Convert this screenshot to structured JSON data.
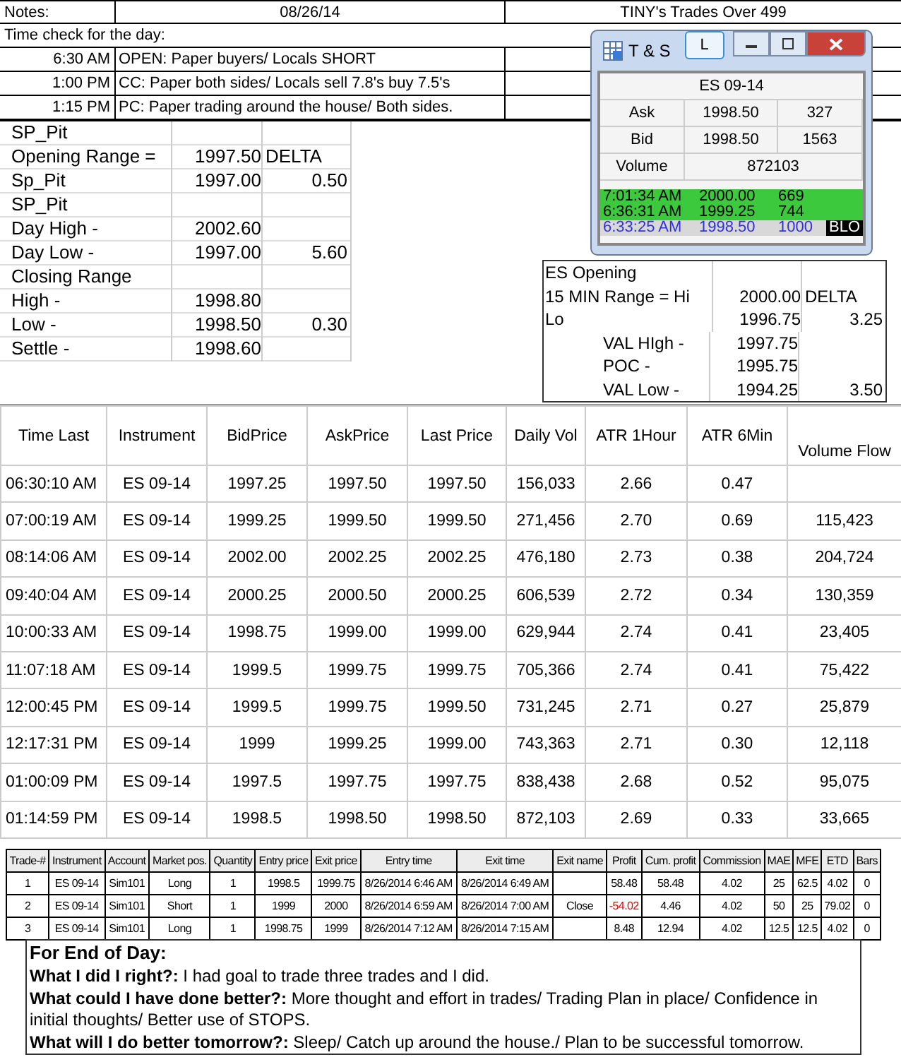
{
  "header": {
    "notes_label": "Notes:",
    "date": "08/26/14",
    "title": "TINY's Trades Over 499"
  },
  "time_check": {
    "title": "Time check for the day:",
    "entries": [
      {
        "time": "6:30 AM",
        "text": "OPEN: Paper buyers/ Locals SHORT"
      },
      {
        "time": "1:00 PM",
        "text": "CC: Paper both sides/ Locals sell 7.8's buy 7.5's"
      },
      {
        "time": "1:15 PM",
        "text": "PC: Paper trading around the house/ Both sides."
      }
    ]
  },
  "sp_pit": [
    {
      "label": "SP_Pit"
    },
    {
      "label": "Opening Range =",
      "value": "1997.50",
      "delta_label": "DELTA"
    },
    {
      "label": "Sp_Pit",
      "value": "1997.00",
      "delta": "0.50"
    },
    {
      "label": "SP_Pit"
    },
    {
      "label": "Day High -",
      "value": "2002.60"
    },
    {
      "label": "Day Low -",
      "value": "1997.00",
      "delta": "5.60"
    },
    {
      "label": "Closing Range"
    },
    {
      "label": "High -",
      "value": "1998.80"
    },
    {
      "label": "Low -",
      "value": "1998.50",
      "delta": "0.30"
    },
    {
      "label": "Settle -",
      "value": "1998.60"
    }
  ],
  "ts_window": {
    "title": "T & S",
    "link_button": "L",
    "symbol": "ES 09-14",
    "quotes": [
      {
        "label": "Ask",
        "price": "1998.50",
        "size": "327"
      },
      {
        "label": "Bid",
        "price": "1998.50",
        "size": "1563"
      }
    ],
    "volume_label": "Volume",
    "volume": "872103",
    "prints": [
      {
        "time": "7:01:34 AM",
        "price": "2000.00",
        "size": "669",
        "color": "#3dc93d"
      },
      {
        "time": "6:36:31 AM",
        "price": "1999.25",
        "size": "744",
        "color": "#3dc93d"
      },
      {
        "time": "6:33:25 AM",
        "price": "1998.50",
        "size": "1000",
        "color": "#d8d8d8",
        "flag": "BLO"
      }
    ]
  },
  "es_opening": [
    {
      "label": "ES Opening",
      "kind": "plain"
    },
    {
      "label": "15 MIN Range = Hi",
      "value": "2000.00",
      "delta_label": "DELTA",
      "kind": "plain"
    },
    {
      "label": "Lo",
      "value": "1996.75",
      "delta": "3.25",
      "kind": "plain"
    },
    {
      "label": "VAL HIgh  -",
      "value": "1997.75",
      "kind": "indented"
    },
    {
      "label": "POC  -",
      "value": "1995.75",
      "kind": "indented"
    },
    {
      "label": "VAL Low  -",
      "value": "1994.25",
      "delta": "3.50",
      "kind": "indented"
    }
  ],
  "market_table": {
    "columns": [
      "Time Last",
      "Instrument",
      "BidPrice",
      "AskPrice",
      "Last Price",
      "Daily Vol",
      "ATR 1Hour",
      "ATR 6Min",
      "Volume Flow"
    ],
    "rows": [
      [
        "06:30:10 AM",
        "ES 09-14",
        "1997.25",
        "1997.50",
        "1997.50",
        "156,033",
        "2.66",
        "0.47"
      ],
      [
        "07:00:19 AM",
        "ES 09-14",
        "1999.25",
        "1999.50",
        "1999.50",
        "271,456",
        "2.70",
        "0.69",
        "115,423"
      ],
      [
        "08:14:06 AM",
        "ES 09-14",
        "2002.00",
        "2002.25",
        "2002.25",
        "476,180",
        "2.73",
        "0.38",
        "204,724"
      ],
      [
        "09:40:04 AM",
        "ES 09-14",
        "2000.25",
        "2000.50",
        "2000.25",
        "606,539",
        "2.72",
        "0.34",
        "130,359"
      ],
      [
        "10:00:33 AM",
        "ES 09-14",
        "1998.75",
        "1999.00",
        "1999.00",
        "629,944",
        "2.74",
        "0.41",
        "23,405"
      ],
      [
        "11:07:18 AM",
        "ES 09-14",
        "1999.5",
        "1999.75",
        "1999.75",
        "705,366",
        "2.74",
        "0.41",
        "75,422"
      ],
      [
        "12:00:45 PM",
        "ES 09-14",
        "1999.5",
        "1999.75",
        "1999.50",
        "731,245",
        "2.71",
        "0.27",
        "25,879"
      ],
      [
        "12:17:31 PM",
        "ES 09-14",
        "1999",
        "1999.25",
        "1999.00",
        "743,363",
        "2.71",
        "0.30",
        "12,118"
      ],
      [
        "01:00:09 PM",
        "ES 09-14",
        "1997.5",
        "1997.75",
        "1997.75",
        "838,438",
        "2.68",
        "0.52",
        "95,075"
      ],
      [
        "01:14:59 PM",
        "ES 09-14",
        "1998.5",
        "1998.50",
        "1998.50",
        "872,103",
        "2.69",
        "0.33",
        "33,665"
      ]
    ]
  },
  "trades_table": {
    "columns": [
      "Trade-#",
      "Instrument",
      "Account",
      "Market pos.",
      "Quantity",
      "Entry price",
      "Exit price",
      "Entry time",
      "Exit time",
      "Exit name",
      "Profit",
      "Cum. profit",
      "Commission",
      "MAE",
      "MFE",
      "ETD",
      "Bars"
    ],
    "rows": [
      {
        "loss": false,
        "cells": [
          "1",
          "ES 09-14",
          "Sim101",
          "Long",
          "1",
          "1998.5",
          "1999.75",
          "8/26/2014 6:46 AM",
          "8/26/2014 6:49 AM",
          "",
          "58.48",
          "58.48",
          "4.02",
          "25",
          "62.5",
          "4.02",
          "0"
        ]
      },
      {
        "loss": true,
        "cells": [
          "2",
          "ES 09-14",
          "Sim101",
          "Short",
          "1",
          "1999",
          "2000",
          "8/26/2014 6:59 AM",
          "8/26/2014 7:00 AM",
          "Close",
          "-54.02",
          "4.46",
          "4.02",
          "50",
          "25",
          "79.02",
          "0"
        ]
      },
      {
        "loss": false,
        "cells": [
          "3",
          "ES 09-14",
          "Sim101",
          "Long",
          "1",
          "1998.75",
          "1999",
          "8/26/2014 7:12 AM",
          "8/26/2014 7:15 AM",
          "",
          "8.48",
          "12.94",
          "4.02",
          "12.5",
          "12.5",
          "4.02",
          "0"
        ]
      }
    ]
  },
  "end_of_day": {
    "title": "For End of Day:",
    "lines": [
      "**What I did I right?:**  I had goal to trade three trades and I did.",
      "**What could I have done better?:**  More thought and effort in trades/ Trading Plan in place/ Confidence in initial thoughts/ Better use of STOPS.",
      "**What will I do better tomorrow?:**  Sleep/ Catch up around the house./ Plan to be successful tomorrow."
    ]
  }
}
